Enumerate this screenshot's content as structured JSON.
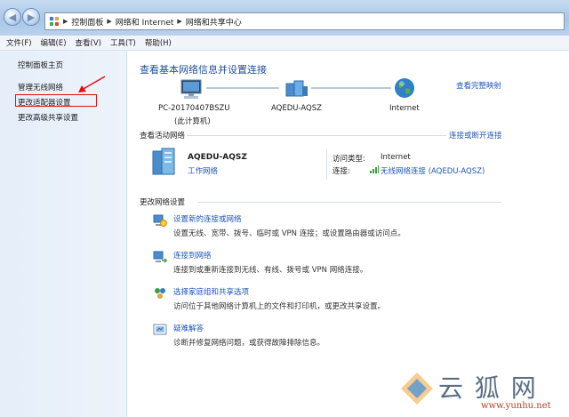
{
  "address_bar": {
    "segments": [
      "控制面板",
      "网络和 Internet",
      "网络和共享中心"
    ]
  },
  "menu": [
    "文件(F)",
    "编辑(E)",
    "查看(V)",
    "工具(T)",
    "帮助(H)"
  ],
  "sidebar": {
    "items": [
      {
        "label": "控制面板主页"
      },
      {
        "label": "管理无线网络"
      },
      {
        "label": "更改适配器设置",
        "highlighted": true
      },
      {
        "label": "更改高级共享设置"
      }
    ]
  },
  "main": {
    "title": "查看基本网络信息并设置连接",
    "full_map_link": "查看完整映射",
    "network_map": {
      "computer_name": "PC-20170407BSZU",
      "computer_sub": "(此计算机)",
      "network_name": "AQEDU-AQSZ",
      "internet_label": "Internet"
    },
    "active_networks": {
      "heading": "查看活动网络",
      "connect_link": "连接或断开连接",
      "network_name": "AQEDU-AQSZ",
      "network_type": "工作网络",
      "access_type_label": "访问类型:",
      "access_type_value": "Internet",
      "connection_label": "连接:",
      "connection_value": "无线网络连接 (AQEDU-AQSZ)"
    },
    "change_settings": {
      "heading": "更改网络设置",
      "tasks": [
        {
          "title": "设置新的连接或网络",
          "desc": "设置无线、宽带、拨号、临时或 VPN 连接；或设置路由器或访问点。"
        },
        {
          "title": "连接到网络",
          "desc": "连接到或重新连接到无线、有线、拨号或 VPN 网络连接。"
        },
        {
          "title": "选择家庭组和共享选项",
          "desc": "访问位于其他网络计算机上的文件和打印机，或更改共享设置。"
        },
        {
          "title": "疑难解答",
          "desc": "诊断并修复网络问题，或获得故障排除信息。"
        }
      ]
    }
  },
  "watermark": {
    "text": "云 狐 网",
    "url": "www.yunhu.net"
  },
  "colors": {
    "link": "#1f56b8",
    "title": "#1f4e99",
    "highlight_box": "#e01010"
  }
}
